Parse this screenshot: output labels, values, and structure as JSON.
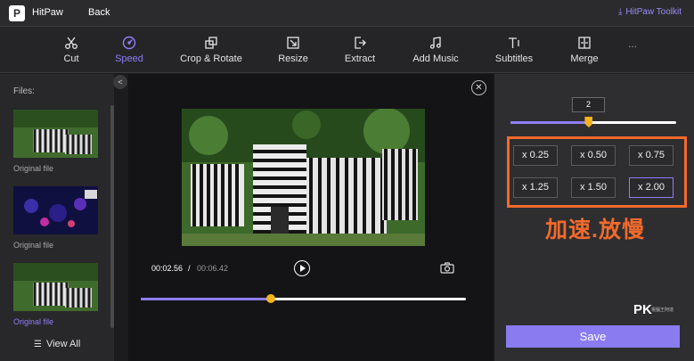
{
  "titlebar": {
    "logo_letter": "P",
    "app_name": "HitPaw",
    "back_label": "Back",
    "toolkit_label": "HitPaw Toolkit"
  },
  "toolbar": {
    "tools": [
      {
        "label": "Cut",
        "icon": "scissors-icon"
      },
      {
        "label": "Speed",
        "icon": "speedometer-icon",
        "active": true
      },
      {
        "label": "Crop & Rotate",
        "icon": "crop-rotate-icon"
      },
      {
        "label": "Resize",
        "icon": "resize-icon"
      },
      {
        "label": "Extract",
        "icon": "extract-icon"
      },
      {
        "label": "Add Music",
        "icon": "music-note-icon"
      },
      {
        "label": "Subtitles",
        "icon": "text-icon"
      },
      {
        "label": "Merge",
        "icon": "merge-icon"
      }
    ],
    "more": "..."
  },
  "files": {
    "title": "Files:",
    "items": [
      {
        "label": "Original file"
      },
      {
        "label": "Original file"
      },
      {
        "label": "Original file",
        "active": true
      }
    ],
    "view_all": "View All"
  },
  "player": {
    "current_time": "00:02.56",
    "separator": "/",
    "total_time": "00:06.42",
    "progress": 0.4
  },
  "speed": {
    "value": "2",
    "slider_position": 0.47,
    "options": [
      "x 0.25",
      "x 0.50",
      "x 0.75",
      "x 1.25",
      "x 1.50",
      "x 2.00"
    ],
    "selected": "x 2.00",
    "save_label": "Save"
  },
  "annotation": {
    "text": "加速.放慢",
    "color": "#f26a2b"
  },
  "watermark": {
    "logo": "PK",
    "sub": "電腦王阿達"
  },
  "colors": {
    "accent": "#8f7ef8",
    "knob": "#f5b41e",
    "highlight": "#f26a2b"
  }
}
